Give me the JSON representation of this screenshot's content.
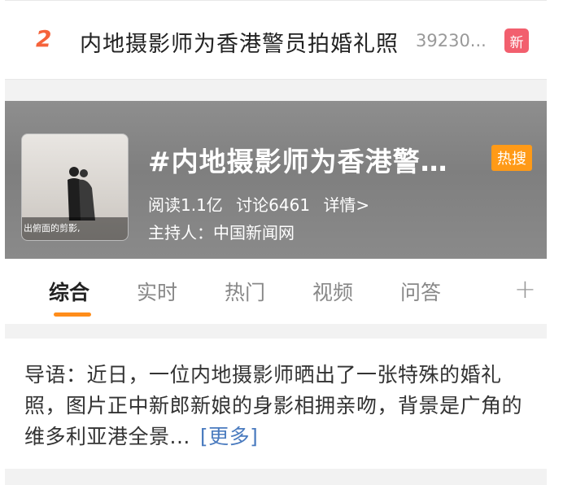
{
  "hot_item": {
    "rank": "2",
    "title": "内地摄影师为香港警员拍婚礼照",
    "count": "39230...",
    "badge": "新"
  },
  "topic": {
    "title": "#内地摄影师为香港警…",
    "tag": "热搜",
    "reads": "阅读1.1亿",
    "discussions": "讨论6461",
    "details": "详情>",
    "host": "主持人：中国新闻网",
    "thumbnail_caption": "出俯面的剪影,"
  },
  "tabs": [
    "综合",
    "实时",
    "热门",
    "视频",
    "问答"
  ],
  "tab_plus": "+",
  "intro": {
    "text": "导语：近日，一位内地摄影师晒出了一张特殊的婚礼照，图片正中新郎新娘的身影相拥亲吻，背景是广角的维多利亚港全景...",
    "more": "[更多]"
  },
  "colors": {
    "rank": "#f5633b",
    "new_badge": "#f25f6e",
    "hot_tag": "#ff9a17",
    "tab_indicator": "#ff8d1a",
    "link": "#4a7bbf"
  }
}
